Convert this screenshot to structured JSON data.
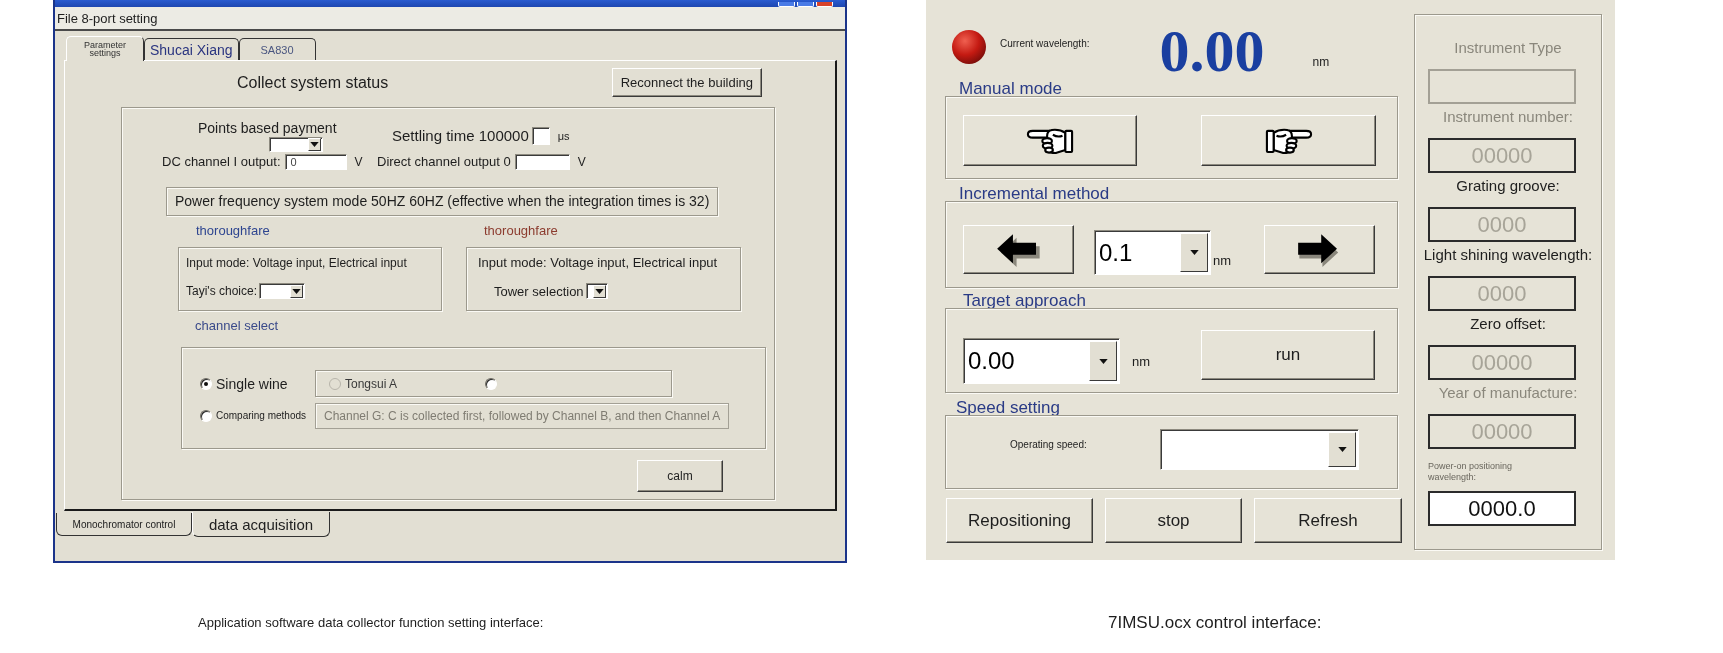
{
  "data_collector_window": {
    "menu_title": "File 8-port setting",
    "top_tabs": [
      {
        "label": "Parameter settings",
        "selected": true
      },
      {
        "label": "Shucai Xiang",
        "selected": false
      },
      {
        "label": "SA830",
        "selected": false
      }
    ],
    "section_title": "Collect system status",
    "reconnect_button": "Reconnect the building",
    "payment_mode_label": "Points based payment",
    "settling_time": {
      "label": "Settling time 100000",
      "unit": "μs"
    },
    "dc_channel_output": {
      "label": "DC channel I output:",
      "value": "0",
      "unit": "V"
    },
    "direct_channel_output": {
      "label": "Direct channel output 0",
      "unit": "V"
    },
    "power_frequency_note": "Power frequency system mode 50HZ 60HZ (effective when the integration times is 32)",
    "channel_groups": [
      {
        "title": "thoroughfare",
        "color": "#2e4590",
        "input_mode": "Input mode: Voltage input, Electrical input",
        "select_label": "Tayi's choice:"
      },
      {
        "title": "thoroughfare",
        "color": "#8c3b2e",
        "input_mode": "Input mode: Voltage input, Electrical input",
        "select_label": "Tower selection"
      }
    ],
    "channel_select": {
      "title": "channel select",
      "modes": [
        {
          "label": "Single wine",
          "selected": true
        },
        {
          "label": "Comparing methods",
          "selected": false
        }
      ],
      "single_channels": [
        {
          "label": "Tongsui A",
          "selected": false,
          "disabled": true
        },
        {
          "selected": false,
          "disabled": false
        }
      ],
      "comparison_order": {
        "value": "Channel G: C is collected first, followed by Channel B, and then Channel A",
        "disabled": true
      }
    },
    "calm_button": "calm",
    "bottom_tabs": [
      {
        "label": "Monochromator control",
        "selected": false
      },
      {
        "label": "data acquisition",
        "selected": true
      }
    ],
    "caption": "Application software data collector function setting interface:"
  },
  "monochromator_panel": {
    "indicator_label": "Current wavelength:",
    "current_wavelength": "0.00",
    "wavelength_unit": "nm",
    "manual_mode": {
      "title": "Manual mode",
      "buttons": [
        {
          "kind": "left"
        },
        {
          "kind": "right"
        }
      ]
    },
    "incremental_method": {
      "title": "Incremental method",
      "step": "0.1",
      "unit": "nm"
    },
    "target_approach": {
      "title": "Target approach",
      "value": "0.00",
      "unit": "nm",
      "run_button": "run"
    },
    "speed_setting": {
      "title": "Speed setting",
      "label": "Operating speed:"
    },
    "action_buttons": [
      "Repositioning",
      "stop",
      "Refresh"
    ],
    "instrument_info": [
      {
        "label": "Instrument Type",
        "label_disabled": true,
        "disabled": true
      },
      {
        "label": "Instrument number:",
        "label_disabled": true,
        "value": "00000",
        "disabled": true
      },
      {
        "label": "Grating groove:",
        "label_disabled": false,
        "value": "0000",
        "disabled": true
      },
      {
        "label": "Light shining wavelength:",
        "label_disabled": false,
        "value": "0000",
        "disabled": true
      },
      {
        "label": "Zero offset:",
        "label_disabled": false,
        "value": "00000",
        "disabled": true
      },
      {
        "label": "Year of manufacture:",
        "label_disabled": true,
        "value": "00000",
        "disabled": true
      }
    ],
    "power_on_wavelength": {
      "label": "Power-on positioning wavelength:",
      "value": "0000.0"
    },
    "caption": "7IMSU.ocx control interface:"
  }
}
